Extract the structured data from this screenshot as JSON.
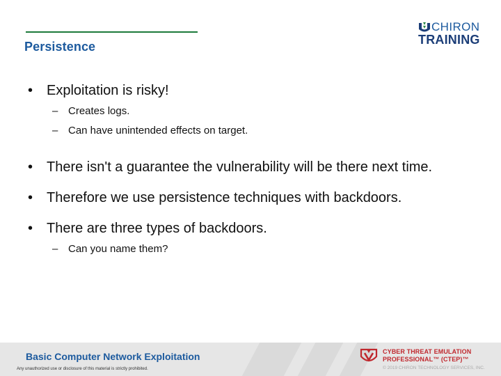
{
  "slide": {
    "title": "Persistence"
  },
  "logo": {
    "top": "CHIRON",
    "bottom": "TRAINING"
  },
  "bullets": [
    {
      "marker": "•",
      "text": "Exploitation is risky!",
      "subs": [
        {
          "marker": "–",
          "text": "Creates logs."
        },
        {
          "marker": "–",
          "text": "Can have unintended effects on target."
        }
      ]
    },
    {
      "marker": "•",
      "text": "There isn't a guarantee the vulnerability will be there next time.",
      "subs": []
    },
    {
      "marker": "•",
      "text": "Therefore we use persistence techniques with backdoors.",
      "subs": []
    },
    {
      "marker": "•",
      "text": "There are three types of backdoors.",
      "subs": [
        {
          "marker": "–",
          "text": "Can you name them?"
        }
      ]
    }
  ],
  "footer": {
    "course": "Basic Computer Network Exploitation",
    "notice": "Any unauthorized use or disclosure of this material is strictly prohibited.",
    "brand_line1": "CYBER THREAT EMULATION",
    "brand_line2": "PROFESSIONAL™ (CTEP)™",
    "copyright": "© 2019 CHIRON TECHNOLOGY SERVICES, INC."
  },
  "colors": {
    "title": "#1c5a9e",
    "title_rule": "#1c7a3a",
    "brand_red": "#c0282e",
    "logo_navy": "#1c3e78"
  }
}
